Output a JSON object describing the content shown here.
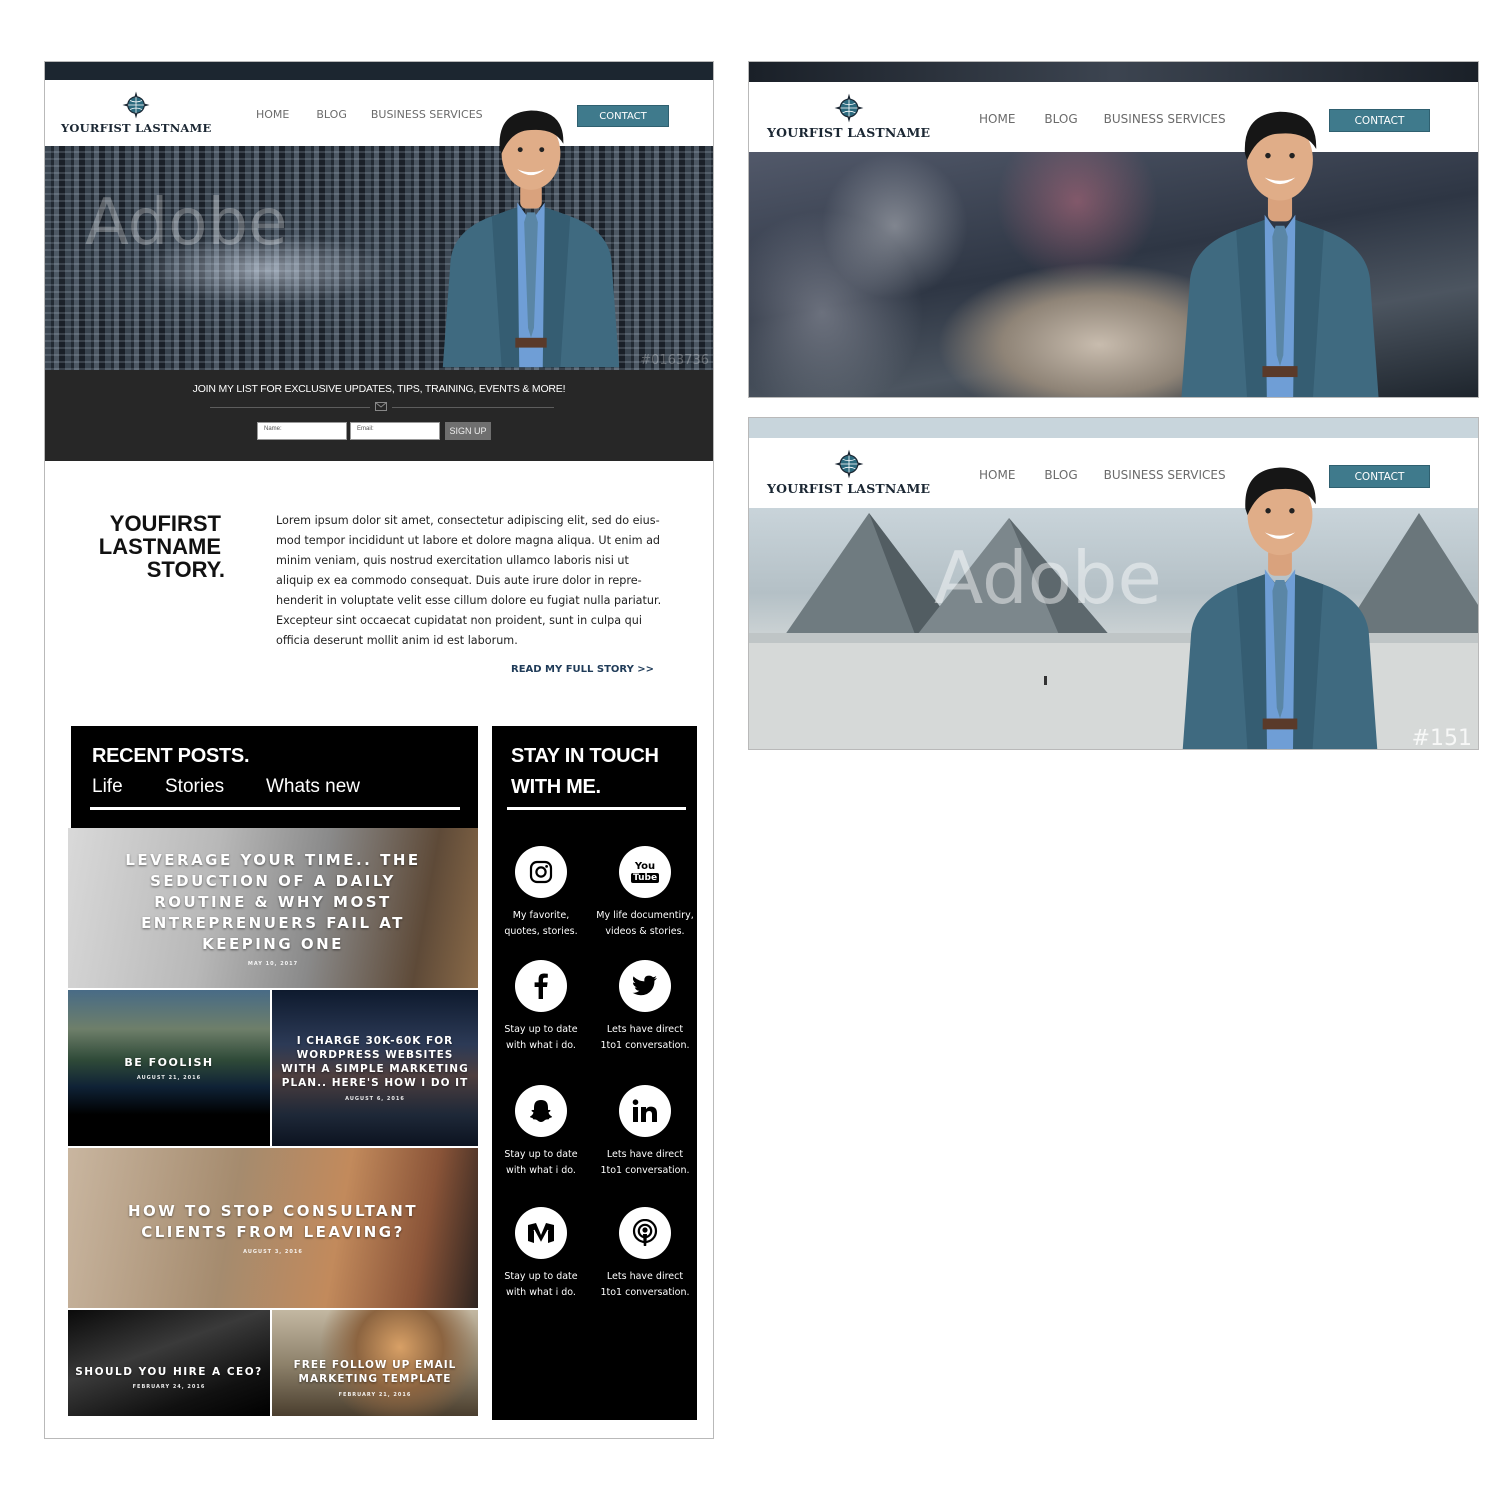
{
  "brand": {
    "logo_text": "YOURFIST LASTNAME"
  },
  "nav": {
    "home": "HOME",
    "blog": "BLOG",
    "services": "BUSINESS SERVICES",
    "contact": "CONTACT"
  },
  "signup": {
    "title": "JOIN MY LIST FOR EXCLUSIVE UPDATES, TIPS, TRAINING, EVENTS & MORE!",
    "name_placeholder": "Name:",
    "email_placeholder": "Email:",
    "button": "SIGN UP"
  },
  "story": {
    "heading_line1": "YOUFIRST",
    "heading_line2": "LASTNAME",
    "heading_line3": "STORY.",
    "body_lines": [
      "Lorem ipsum dolor sit amet, consectetur adipiscing elit, sed do eius-",
      "mod tempor incididunt ut labore et dolore magna aliqua. Ut enim ad",
      "minim veniam, quis nostrud exercitation ullamco laboris nisi ut",
      "aliquip ex ea commodo consequat. Duis aute irure dolor in repre-",
      "henderit in voluptate velit esse cillum dolore eu fugiat nulla pariatur.",
      "Excepteur sint occaecat cupidatat non proident, sunt in culpa qui",
      "officia deserunt mollit anim id est laborum."
    ],
    "link": "READ MY FULL STORY >>"
  },
  "recent_posts": {
    "title": "RECENT POSTS.",
    "tabs": [
      "Life",
      "Stories",
      "Whats new"
    ],
    "posts": [
      {
        "title": "LEVERAGE YOUR TIME.. THE SEDUCTION OF A DAILY ROUTINE & WHY MOST ENTREPRENUERS FAIL AT KEEPING ONE",
        "date": "MAY 10, 2017"
      },
      {
        "title": "BE FOOLISH",
        "date": "AUGUST 21, 2016"
      },
      {
        "title": "I CHARGE 30K-60K FOR WORDPRESS WEBSITES WITH A SIMPLE MARKETING PLAN.. HERE'S HOW I DO IT",
        "date": "AUGUST 6, 2016"
      },
      {
        "title": "HOW TO STOP CONSULTANT CLIENTS FROM LEAVING?",
        "date": "AUGUST 3, 2016"
      },
      {
        "title": "SHOULD YOU HIRE A CEO?",
        "date": "FEBRUARY 24, 2016"
      },
      {
        "title": "FREE FOLLOW UP EMAIL MARKETING TEMPLATE",
        "date": "FEBRUARY 21, 2016"
      }
    ]
  },
  "stay_in_touch": {
    "title_line1": "STAY IN TOUCH",
    "title_line2": "WITH ME.",
    "items": [
      {
        "icon": "instagram-icon",
        "caption": "My favorite,\nquotes, stories."
      },
      {
        "icon": "youtube-icon",
        "caption": "My life documentiry,\nvideos & stories."
      },
      {
        "icon": "facebook-icon",
        "caption": "Stay up to date\nwith what i do."
      },
      {
        "icon": "twitter-icon",
        "caption": "Lets have direct\n1to1 conversation."
      },
      {
        "icon": "snapchat-icon",
        "caption": "Stay up to date\nwith what i do."
      },
      {
        "icon": "linkedin-icon",
        "caption": "Lets have direct\n1to1 conversation."
      },
      {
        "icon": "medium-icon",
        "caption": "Stay up to date\nwith what i do."
      },
      {
        "icon": "podcast-icon",
        "caption": "Lets have direct\n1to1 conversation."
      }
    ],
    "youtube_top": "You",
    "youtube_bottom": "Tube"
  },
  "watermarks": {
    "adobe": "Adobe",
    "tag": "#151",
    "number": "#0163736"
  },
  "colors": {
    "contact_button": "#3f7a8c",
    "signup_bar": "#272727",
    "panel": "#000000",
    "logo_text": "#1b2733"
  }
}
